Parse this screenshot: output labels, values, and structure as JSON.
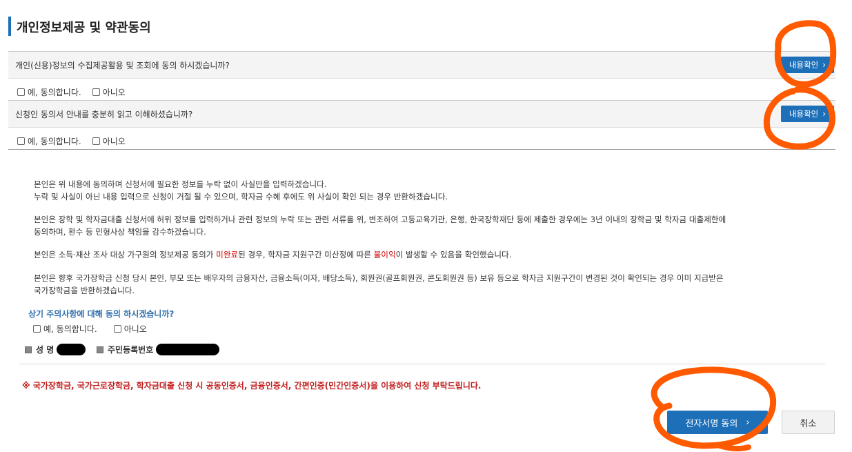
{
  "page": {
    "title": "개인정보제공 및 약관동의"
  },
  "questions": [
    {
      "text": "개인(신용)정보의 수집제공활용 및 조회에 동의 하시겠습니까?",
      "button": "내용확인",
      "agree": "예, 동의합니다.",
      "disagree": "아니오"
    },
    {
      "text": "신청인 동의서 안내를 충분히 읽고 이해하셨습니까?",
      "button": "내용확인",
      "agree": "예, 동의합니다.",
      "disagree": "아니오"
    }
  ],
  "notice": {
    "p1_l1": "본인은 위 내용에 동의하며 신청서에 필요한 정보를 누락 없이 사실만을 입력하겠습니다.",
    "p1_l2": "누락 및 사실이 아닌 내용 입력으로 신청이 거절 될 수 있으며, 학자금 수혜 후에도 위 사실이 확인 되는 경우 반환하겠습니다.",
    "p2_l1": "본인은 장학 및 학자금대출 신청서에 허위 정보를 입력하거나 관련 정보의 누락 또는 관련 서류를 위, 변조하여 고등교육기관, 은행, 한국장학재단 등에 제출한 경우에는 3년 이내의 장학금 및 학자금 대출제한에",
    "p2_l2": "동의하며, 환수 등 민형사상 책임을 감수하겠습니다.",
    "p3_a": "본인은 소득·재산 조사 대상 가구원의 정보제공 동의가 ",
    "p3_red1": "미완료",
    "p3_b": "된 경우, 학자금 지원구간 미산정에 따른 ",
    "p3_red2": "불이익",
    "p3_c": "이 발생할 수 있음을 확인했습니다.",
    "p4_l1": "본인은 향후 국가장학금 신청 당시 본인, 부모 또는 배우자의 금융자산, 금융소득(이자, 배당소득), 회원권(골프회원권, 콘도회원권 등) 보유 등으로 학자금 지원구간이 변경된 것이 확인되는 경우 이미 지급받은",
    "p4_l2": "국가장학금을 반환하겠습니다."
  },
  "caution": {
    "question": "상기 주의사항에 대해 동의 하시겠습니까?",
    "agree": "예, 동의합니다.",
    "disagree": "아니오"
  },
  "person": {
    "name_label": "성 명",
    "rrn_label": "주민등록번호"
  },
  "warning": "※ 국가장학금, 국가근로장학금, 학자금대출 신청 시 공동인증서, 금융인증서, 간편인증(민간인증서)을 이용하여 신청 부탁드립니다.",
  "buttons": {
    "sign": "전자서명 동의",
    "cancel": "취소"
  },
  "colors": {
    "accent": "#1d6fb8",
    "warning": "#c21f1f",
    "annotation": "#ff5a00"
  },
  "icons": {
    "chevron": "chevron-right-icon",
    "bullet": "square-bullet-icon"
  }
}
